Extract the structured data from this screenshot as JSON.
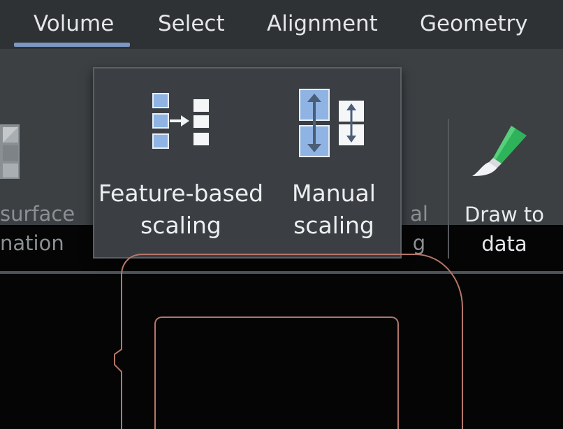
{
  "tabs": [
    {
      "label": "Volume",
      "active": true
    },
    {
      "label": "Select",
      "active": false
    },
    {
      "label": "Alignment",
      "active": false
    },
    {
      "label": "Geometry",
      "active": false
    }
  ],
  "ribbon": {
    "left_partial": {
      "line1": "surface",
      "line2": "nation",
      "icon": "volume-grid-icon"
    },
    "hidden_partial": {
      "line1": "al",
      "line2": "g"
    },
    "draw_to_data": {
      "label": "Draw to data",
      "icon": "paintbrush-icon"
    }
  },
  "popup": {
    "items": [
      {
        "label": "Feature-based scaling",
        "icon": "feature-based-scaling-icon"
      },
      {
        "label": "Manual scaling",
        "icon": "manual-scaling-icon"
      }
    ]
  },
  "colors": {
    "tabbar": "#2f3234",
    "ribbon": "#3c4043",
    "popup": "#3b3f43",
    "accent": "#7b98c3",
    "canvas": "#050505",
    "outline": "#b5766a",
    "icon_blue": "#8fb4e3",
    "brush_green": "#2fb35a"
  }
}
